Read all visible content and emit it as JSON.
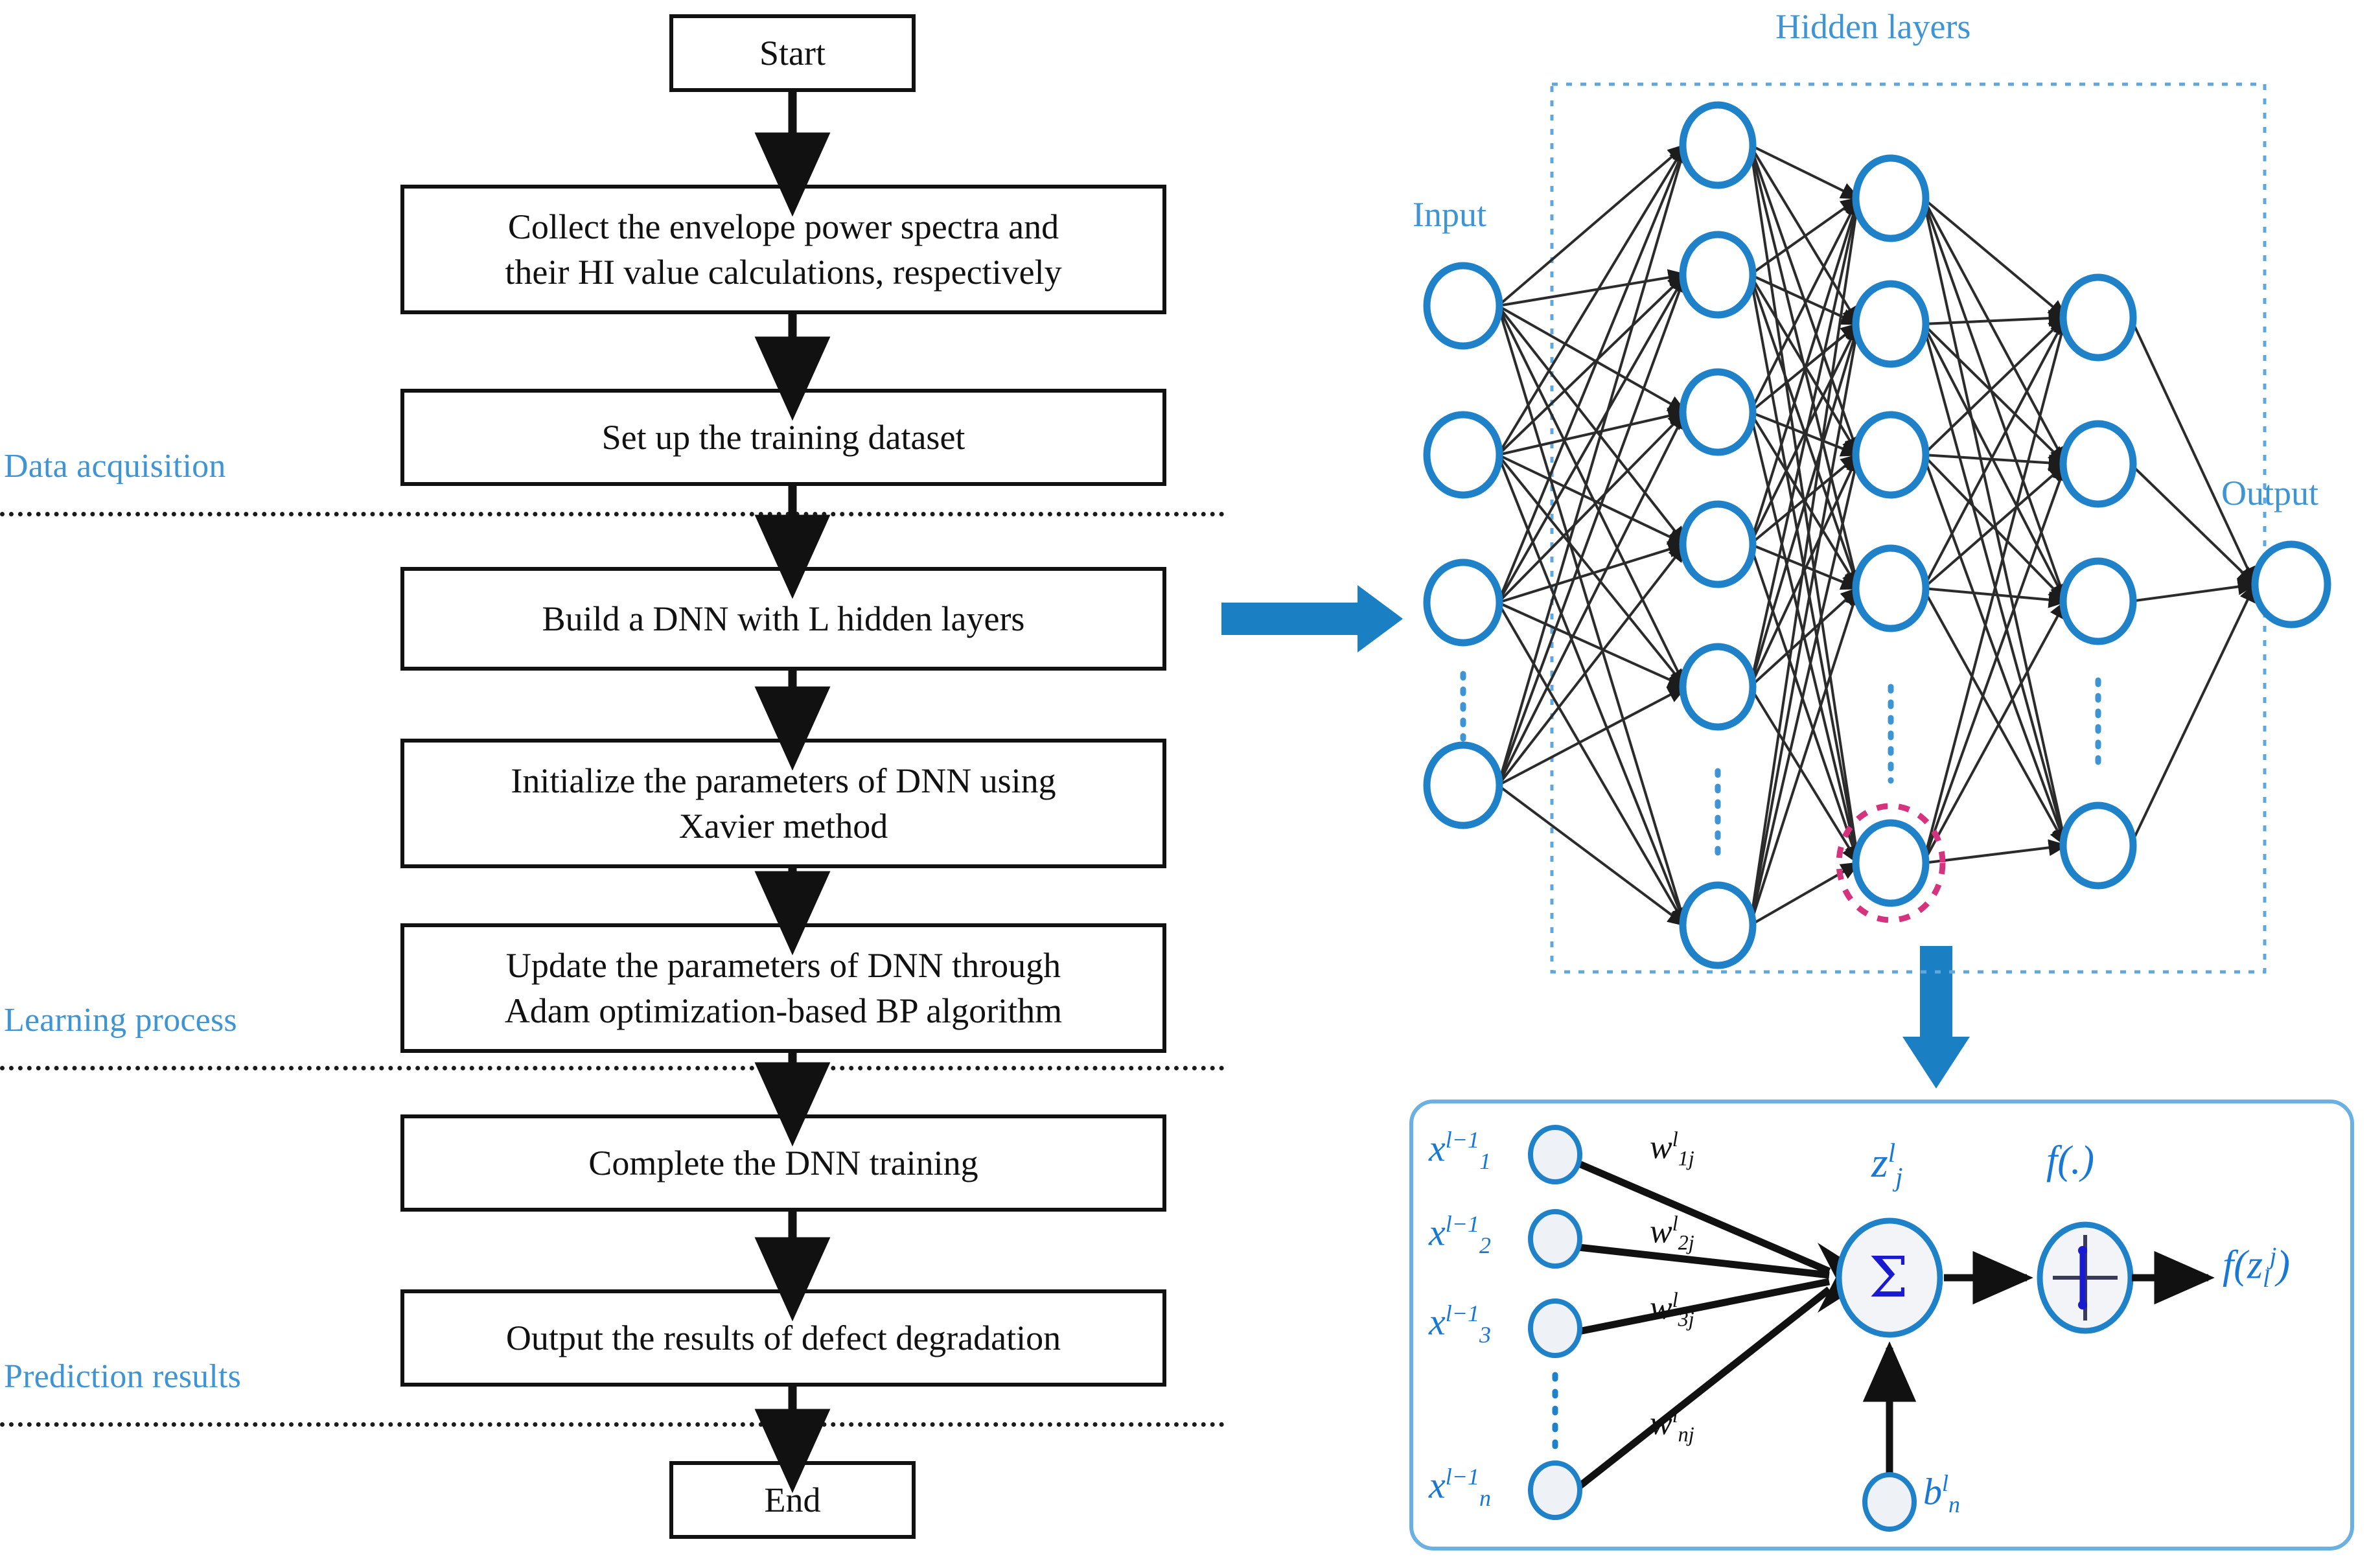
{
  "figure": {
    "title": "DNN-based defect degradation prediction flowchart",
    "accent_blue": "#3f95d3",
    "arrow_blue": "#1b7fc4",
    "node_blue": "#1f82c9",
    "highlight_pink": "#d6337e",
    "math_blue": "#1878d4",
    "sigma_color": "#1a1ad0",
    "line_black": "#111111"
  },
  "flowchart": {
    "boxes": [
      {
        "id": "start",
        "label": "Start"
      },
      {
        "id": "collect",
        "label": "Collect the envelope power spectra and\ntheir HI value calculations, respectively"
      },
      {
        "id": "dataset",
        "label": "Set up the training dataset"
      },
      {
        "id": "build",
        "label": "Build a DNN with L hidden layers"
      },
      {
        "id": "init",
        "label": "Initialize the parameters of DNN using\nXavier method"
      },
      {
        "id": "update",
        "label": "Update the parameters of DNN through\nAdam optimization-based BP algorithm"
      },
      {
        "id": "complete",
        "label": "Complete the DNN training"
      },
      {
        "id": "output",
        "label": "Output the results of defect degradation"
      },
      {
        "id": "end",
        "label": "End"
      }
    ],
    "stage_labels": [
      {
        "id": "data-acquisition",
        "label": "Data acquisition"
      },
      {
        "id": "learning-process",
        "label": "Learning process"
      },
      {
        "id": "prediction-results",
        "label": "Prediction results"
      }
    ]
  },
  "network": {
    "input_label": "Input",
    "hidden_label": "Hidden layers",
    "output_label": "Output",
    "input_nodes": 4,
    "hidden_layers": 3,
    "hidden_nodes_per_layer": [
      6,
      5,
      4
    ],
    "output_nodes": 1,
    "ellipsis_marker": "vertical-dots",
    "highlighted_node": "hidden-layer-2-last-node"
  },
  "neuron_panel": {
    "inputs": [
      {
        "base": "x",
        "sub": "1",
        "sup": "l−1"
      },
      {
        "base": "x",
        "sub": "2",
        "sup": "l−1"
      },
      {
        "base": "x",
        "sub": "3",
        "sup": "l−1"
      },
      {
        "base": "x",
        "sub": "n",
        "sup": "l−1"
      }
    ],
    "weights": [
      {
        "base": "w",
        "sub": "1j",
        "sup": "l"
      },
      {
        "base": "w",
        "sub": "2j",
        "sup": "l"
      },
      {
        "base": "w",
        "sub": "3j",
        "sup": "l"
      },
      {
        "base": "w",
        "sub": "nj",
        "sup": "l"
      }
    ],
    "bias": {
      "base": "b",
      "sub": "n",
      "sup": "l"
    },
    "sum_label": {
      "base": "z",
      "sub": "j",
      "sup": "l"
    },
    "sum_glyph": "Σ",
    "activation_label": "f(.)",
    "activation_glyph": "step-function-icon",
    "output_label": "f(z",
    "output_sub": "j",
    "output_sup": "l",
    "output_close": ")"
  }
}
